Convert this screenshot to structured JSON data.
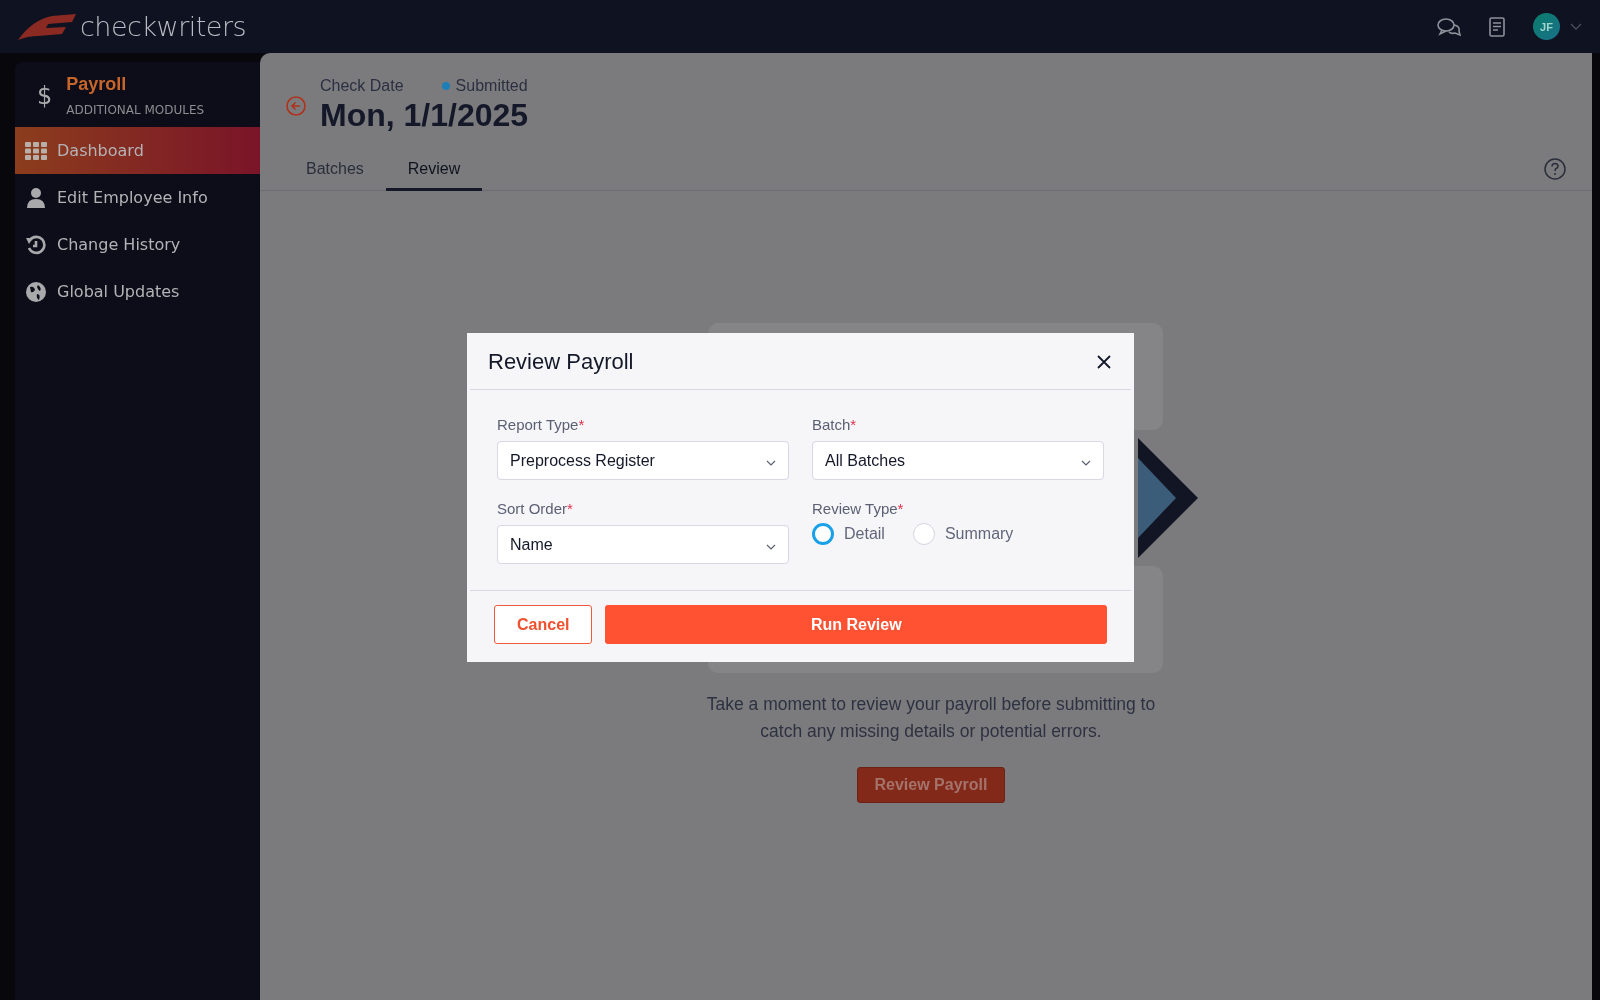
{
  "topbar": {
    "logo_text": "checkwriters",
    "avatar_initials": "JF"
  },
  "sidebar": {
    "module_icon": "$",
    "module_title": "Payroll",
    "module_subtitle": "ADDITIONAL MODULES",
    "items": [
      {
        "label": "Dashboard",
        "selected": true
      },
      {
        "label": "Edit Employee Info",
        "selected": false
      },
      {
        "label": "Change History",
        "selected": false
      },
      {
        "label": "Global Updates",
        "selected": false
      }
    ]
  },
  "header": {
    "caption": "Check Date",
    "status": "Submitted",
    "date": "Mon, 1/1/2025"
  },
  "tabs": [
    {
      "label": "Batches",
      "selected": false
    },
    {
      "label": "Review",
      "selected": true
    }
  ],
  "review_panel": {
    "message": "Take a moment to review your payroll before submitting to catch any missing details or potential errors.",
    "button": "Review Payroll"
  },
  "modal": {
    "title": "Review Payroll",
    "fields": [
      {
        "kind": "select",
        "label": "Report Type",
        "required_mark": "*",
        "value": "Preprocess Register"
      },
      {
        "kind": "select",
        "label": "Batch",
        "required_mark": "*",
        "value": "All Batches"
      },
      {
        "kind": "select",
        "label": "Sort Order",
        "required_mark": "*",
        "value": "Name"
      },
      {
        "kind": "radio",
        "label": "Review Type",
        "required_mark": "*",
        "options": [
          {
            "label": "Detail",
            "selected": true
          },
          {
            "label": "Summary",
            "selected": false
          }
        ]
      }
    ],
    "cancel": "Cancel",
    "submit": "Run Review"
  }
}
